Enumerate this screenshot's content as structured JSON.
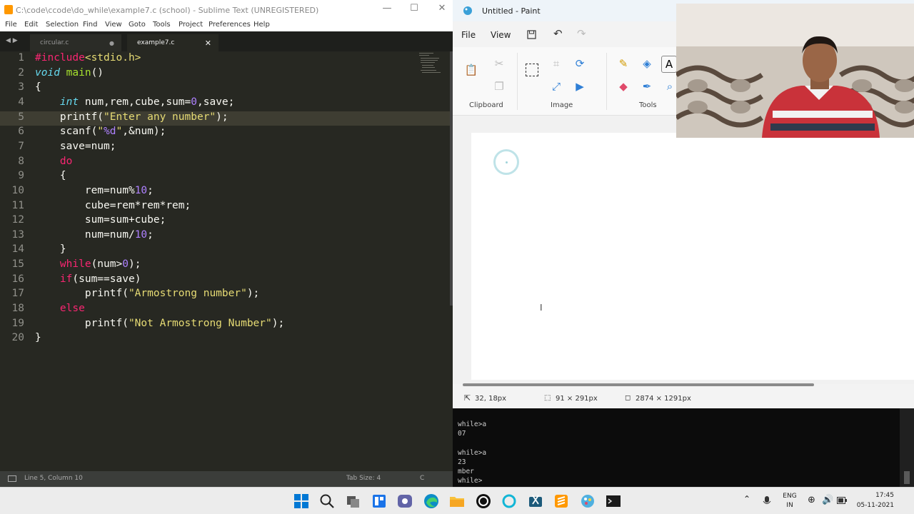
{
  "sublime": {
    "title": "C:\\code\\ccode\\do_while\\example7.c (school) - Sublime Text (UNREGISTERED)",
    "menu": [
      "File",
      "Edit",
      "Selection",
      "Find",
      "View",
      "Goto",
      "Tools",
      "Project",
      "Preferences",
      "Help"
    ],
    "tabs": [
      {
        "label": "circular.c",
        "active": false
      },
      {
        "label": "example7.c",
        "active": true
      }
    ],
    "code_lines": [
      {
        "n": "1",
        "segs": [
          [
            "kw",
            "#include"
          ],
          [
            "str",
            "<stdio.h>"
          ]
        ]
      },
      {
        "n": "2",
        "segs": [
          [
            "ty",
            "void"
          ],
          [
            "",
            " "
          ],
          [
            "fn",
            "main"
          ],
          [
            "",
            "()"
          ]
        ]
      },
      {
        "n": "3",
        "segs": [
          [
            "",
            "{"
          ]
        ]
      },
      {
        "n": "4",
        "segs": [
          [
            "",
            "    "
          ],
          [
            "ty",
            "int"
          ],
          [
            "",
            " num,rem,cube,sum="
          ],
          [
            "num",
            "0"
          ],
          [
            "",
            ",save;"
          ]
        ]
      },
      {
        "n": "5",
        "segs": [
          [
            "",
            "    printf("
          ],
          [
            "str",
            "\"Enter any number\""
          ],
          [
            "",
            ");"
          ]
        ]
      },
      {
        "n": "6",
        "segs": [
          [
            "",
            "    scanf("
          ],
          [
            "str",
            "\""
          ],
          [
            "num",
            "%d"
          ],
          [
            "str",
            "\""
          ],
          [
            "",
            ",&num);"
          ]
        ]
      },
      {
        "n": "7",
        "segs": [
          [
            "",
            "    save=num;"
          ]
        ]
      },
      {
        "n": "8",
        "segs": [
          [
            "",
            "    "
          ],
          [
            "kw",
            "do"
          ]
        ]
      },
      {
        "n": "9",
        "segs": [
          [
            "",
            "    {"
          ]
        ]
      },
      {
        "n": "10",
        "segs": [
          [
            "",
            "        rem=num%"
          ],
          [
            "num",
            "10"
          ],
          [
            "",
            ";"
          ]
        ]
      },
      {
        "n": "11",
        "segs": [
          [
            "",
            "        cube=rem*rem*rem;"
          ]
        ]
      },
      {
        "n": "12",
        "segs": [
          [
            "",
            "        sum=sum+cube;"
          ]
        ]
      },
      {
        "n": "13",
        "segs": [
          [
            "",
            "        num=num/"
          ],
          [
            "num",
            "10"
          ],
          [
            "",
            ";"
          ]
        ]
      },
      {
        "n": "14",
        "segs": [
          [
            "",
            "    }"
          ]
        ]
      },
      {
        "n": "15",
        "segs": [
          [
            "",
            "    "
          ],
          [
            "kw",
            "while"
          ],
          [
            "",
            "(num>"
          ],
          [
            "num",
            "0"
          ],
          [
            "",
            ");"
          ]
        ]
      },
      {
        "n": "16",
        "segs": [
          [
            "",
            "    "
          ],
          [
            "kw",
            "if"
          ],
          [
            "",
            "(sum==save)"
          ]
        ]
      },
      {
        "n": "17",
        "segs": [
          [
            "",
            "        printf("
          ],
          [
            "str",
            "\"Armostrong number\""
          ],
          [
            "",
            ");"
          ]
        ]
      },
      {
        "n": "18",
        "segs": [
          [
            "",
            "    "
          ],
          [
            "kw",
            "else"
          ]
        ]
      },
      {
        "n": "19",
        "segs": [
          [
            "",
            "        printf("
          ],
          [
            "str",
            "\"Not Armostrong Number\""
          ],
          [
            "",
            ");"
          ]
        ]
      },
      {
        "n": "20",
        "segs": [
          [
            "",
            "}"
          ]
        ]
      }
    ],
    "current_line": 5,
    "status": {
      "position": "Line 5, Column 10",
      "tab_size": "Tab Size: 4",
      "syntax": "C"
    }
  },
  "paint": {
    "title": "Untitled - Paint",
    "menu": [
      "File",
      "View"
    ],
    "groups": [
      "Clipboard",
      "Image",
      "Tools"
    ],
    "status": {
      "cursor": "32, 18px",
      "selection": "91 × 291px",
      "canvas": "2874 × 1291px"
    }
  },
  "console": {
    "lines": [
      "while>a",
      "07",
      "",
      "while>a",
      "23",
      "mber",
      "while>"
    ]
  },
  "taskbar": {
    "language": "ENG",
    "region": "IN",
    "time": "17:45",
    "date": "05-11-2021"
  },
  "colors": {
    "sublime_bg": "#272822",
    "keyword": "#f92672",
    "type": "#66d9ef",
    "function": "#a6e22e",
    "number": "#ae81ff",
    "string": "#e6db74"
  }
}
